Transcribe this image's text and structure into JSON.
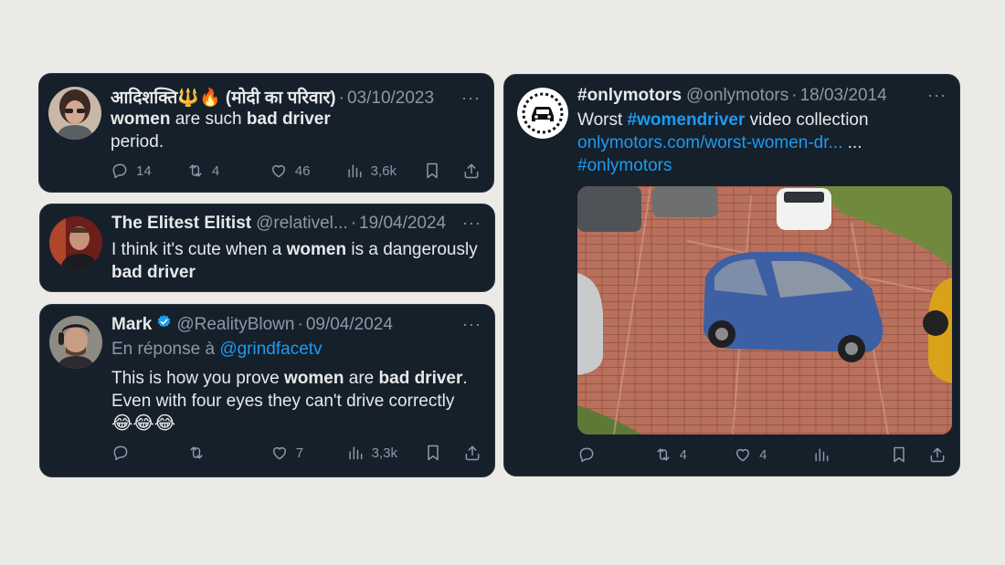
{
  "tweets": [
    {
      "name": "आदिशक्ति🔱🔥 (मोदी का परिवार)",
      "handle": "",
      "date": "03/10/2023",
      "more": "···",
      "line1": {
        "b1": "women",
        "t1": " are such ",
        "b2": "bad driver"
      },
      "line2": "period.",
      "stats": {
        "replies": "14",
        "retweets": "4",
        "likes": "46",
        "views": "3,6k"
      }
    },
    {
      "name": "The Elitest Elitist",
      "handle": "@relativel...",
      "date": "19/04/2024",
      "more": "···",
      "line1": {
        "t1": "I think it's cute when a ",
        "b1": "women",
        "t2": " is a dangerously"
      },
      "line2b": "bad driver"
    },
    {
      "name": "Mark",
      "handle": "@RealityBlown",
      "date": "09/04/2024",
      "more": "···",
      "reply_prefix": "En réponse à ",
      "reply_handle": "@grindfacetv",
      "line1": {
        "t1": "This is how you prove ",
        "b1": "women",
        "t2": " are ",
        "b2": "bad driver",
        "t3": "."
      },
      "line2": "Even with four eyes they can't drive correctly",
      "emojis": "😂😂😂",
      "stats": {
        "replies": "",
        "retweets": "",
        "likes": "7",
        "views": "3,3k"
      }
    },
    {
      "name": "#onlymotors",
      "handle": "@onlymotors",
      "date": "18/03/2014",
      "more": "···",
      "line1": {
        "t1": "Worst ",
        "h1": "#womendriver",
        "t2": " video collection"
      },
      "url": "onlymotors.com/worst-women-dr...",
      "url_suffix": " ...",
      "hashtag": "#onlymotors",
      "stats": {
        "replies": "",
        "retweets": "4",
        "likes": "4",
        "views": ""
      }
    }
  ],
  "separator": "·",
  "colors": {
    "background": "#ebeae6",
    "card": "#15202b",
    "link": "#1d9bf0",
    "muted": "#8b98a5",
    "text": "#e7e9ea"
  }
}
